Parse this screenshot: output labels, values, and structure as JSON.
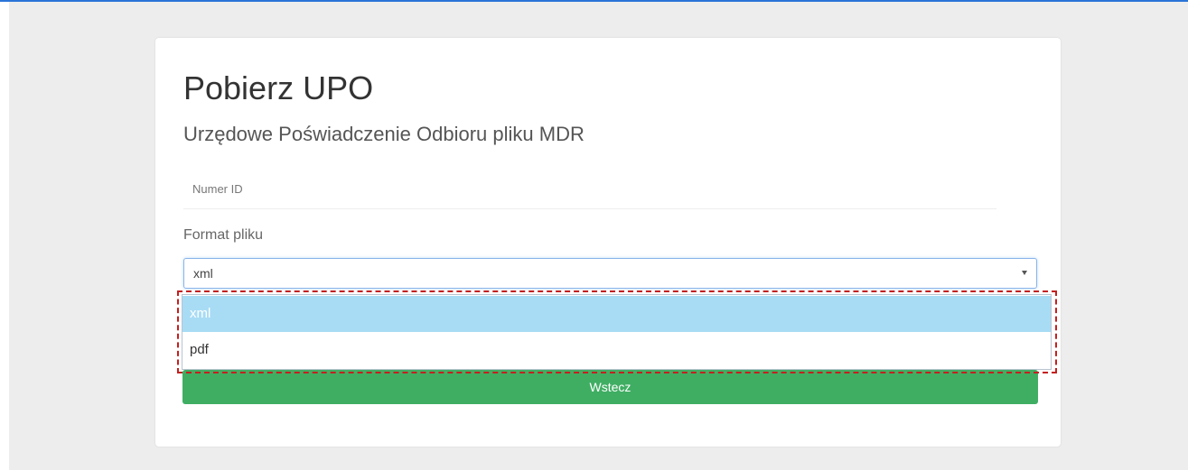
{
  "form": {
    "title": "Pobierz UPO",
    "subtitle": "Urzędowe Poświadczenie Odbioru pliku MDR",
    "id_placeholder": "Numer ID",
    "format_label": "Format pliku",
    "format_value": "xml",
    "back_label": "Wstecz"
  },
  "dropdown": {
    "options": [
      "xml",
      "pdf"
    ],
    "highlighted": "xml"
  },
  "colors": {
    "accent_blue": "#2a74d8",
    "button_green": "#3fae63",
    "option_highlight": "#a8dcf5",
    "annotation_red": "#c3201f"
  }
}
